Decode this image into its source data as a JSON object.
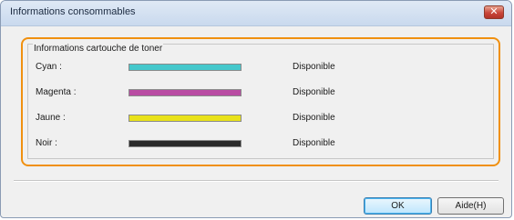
{
  "window": {
    "title": "Informations consommables"
  },
  "group": {
    "title": "Informations cartouche de toner",
    "rows": [
      {
        "label": "Cyan :",
        "status": "Disponible",
        "color": "#45c8cc"
      },
      {
        "label": "Magenta :",
        "status": "Disponible",
        "color": "#b94ca3"
      },
      {
        "label": "Jaune :",
        "status": "Disponible",
        "color": "#e9e21a"
      },
      {
        "label": "Noir :",
        "status": "Disponible",
        "color": "#2a2a2a"
      }
    ]
  },
  "buttons": {
    "ok": "OK",
    "help": "Aide(H)"
  },
  "colors": {
    "highlight": "#f0900f"
  }
}
